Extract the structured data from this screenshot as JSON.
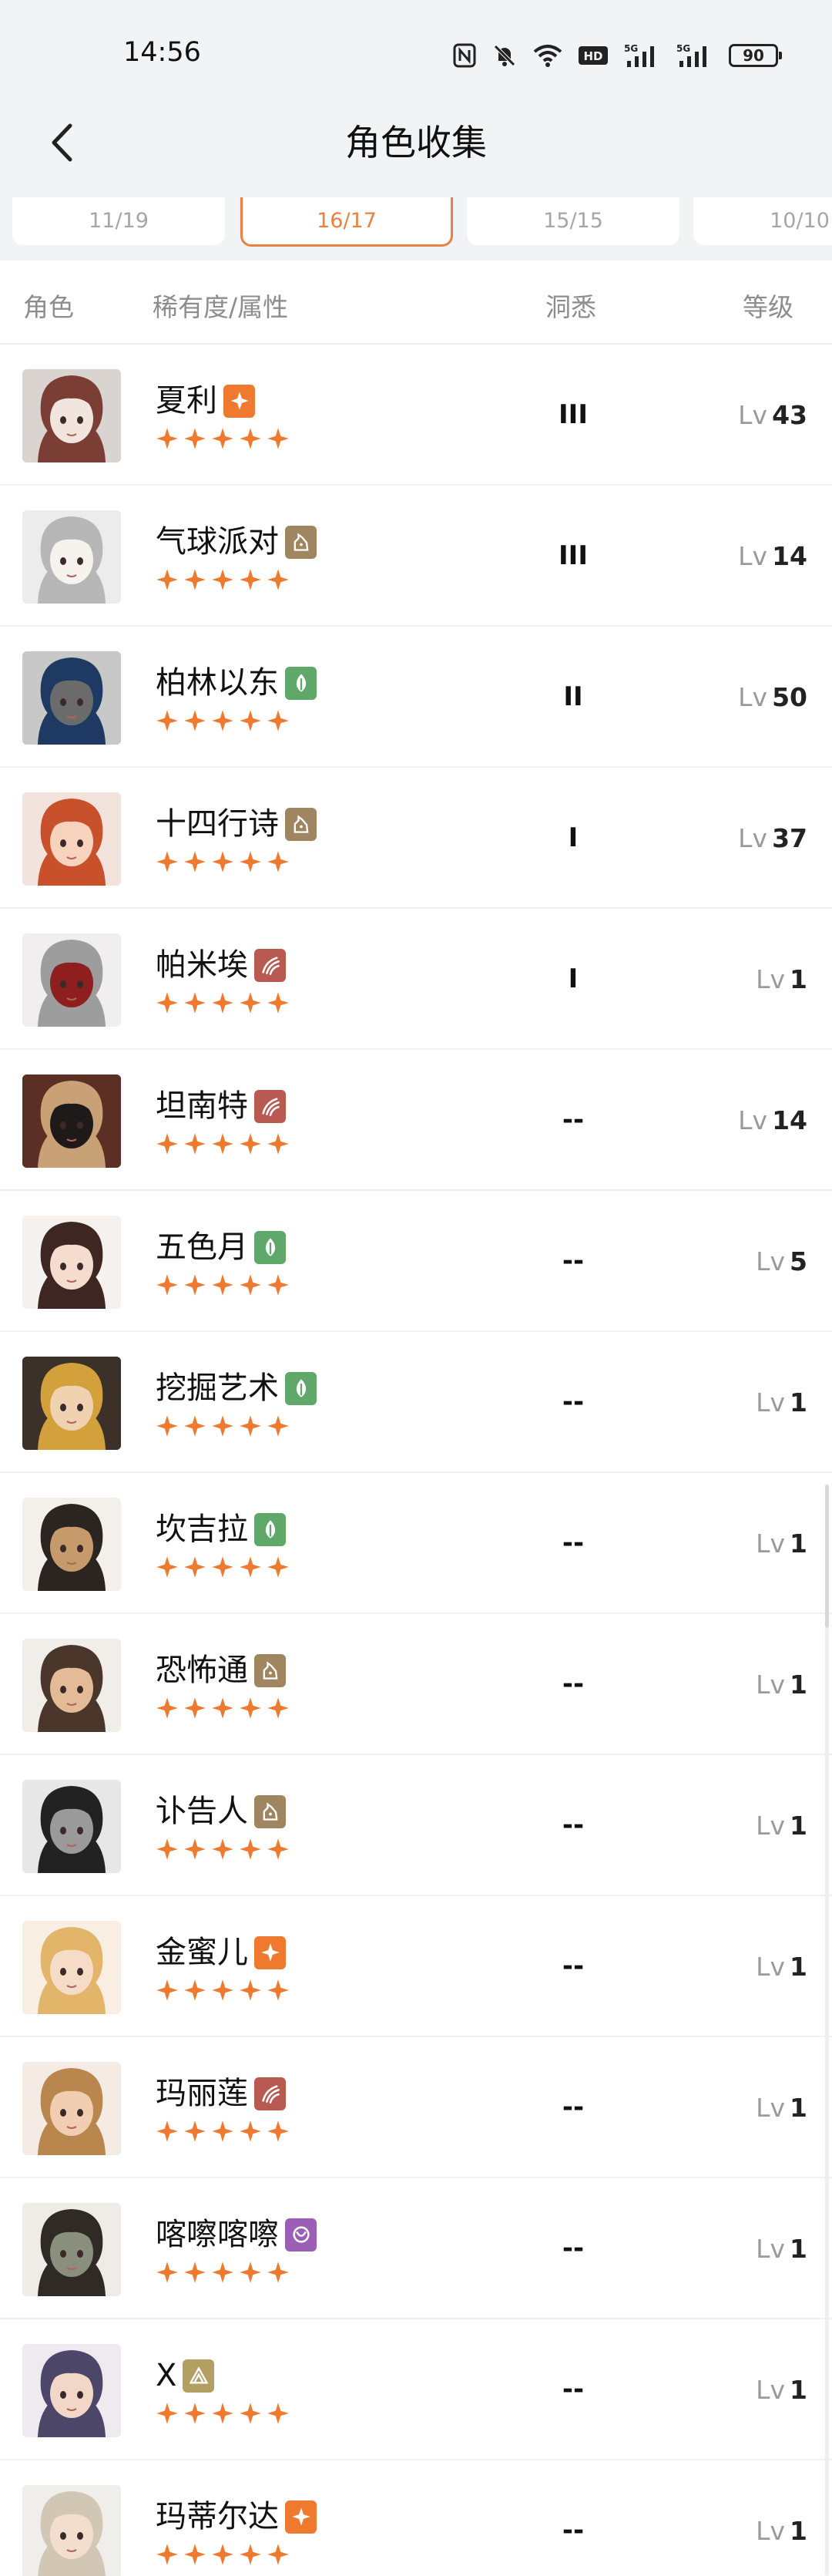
{
  "status": {
    "time": "14:56",
    "battery": "90"
  },
  "header": {
    "title": "角色收集"
  },
  "tabs": [
    "11/19",
    "16/17",
    "15/15",
    "10/10"
  ],
  "columns": {
    "character": "角色",
    "rarity": "稀有度/属性",
    "familiarity": "洞悉",
    "level": "等级"
  },
  "level_prefix": "Lv",
  "colors": {
    "accent": "#e98240",
    "star": "#ef7a2f",
    "star_attr": "#4f86c9",
    "beast": "#a08660",
    "plant": "#5fa86a",
    "mineral": "#b85a52",
    "spirit": "#9b5fb8",
    "intellect": "#b2a062"
  },
  "characters": [
    {
      "name": "夏利",
      "attr": "star",
      "attr_icon": "star-attribute-icon",
      "stars": 5,
      "familiarity": "III",
      "level": "43",
      "avatar": [
        "#d9d4cf",
        "#7a3e35",
        "#f2e5de"
      ]
    },
    {
      "name": "气球派对",
      "attr": "beast",
      "attr_icon": "beast-attribute-icon",
      "stars": 5,
      "familiarity": "III",
      "level": "14",
      "avatar": [
        "#ececec",
        "#b7b7b7",
        "#f6f2ee"
      ]
    },
    {
      "name": "柏林以东",
      "attr": "plant",
      "attr_icon": "plant-attribute-icon",
      "stars": 5,
      "familiarity": "II",
      "level": "50",
      "avatar": [
        "#c8c8c8",
        "#1e3a63",
        "#6b6b6b"
      ]
    },
    {
      "name": "十四行诗",
      "attr": "beast",
      "attr_icon": "beast-attribute-icon",
      "stars": 5,
      "familiarity": "I",
      "level": "37",
      "avatar": [
        "#f2e3dc",
        "#c8502a",
        "#f7d2bd"
      ]
    },
    {
      "name": "帕米埃",
      "attr": "mineral",
      "attr_icon": "mineral-attribute-icon",
      "stars": 5,
      "familiarity": "I",
      "level": "1",
      "avatar": [
        "#f0eeee",
        "#9d9d9d",
        "#8f1e1e"
      ]
    },
    {
      "name": "坦南特",
      "attr": "mineral",
      "attr_icon": "mineral-attribute-icon",
      "stars": 5,
      "familiarity": "--",
      "level": "14",
      "avatar": [
        "#5c2f25",
        "#c9a177",
        "#1f1a1a"
      ]
    },
    {
      "name": "五色月",
      "attr": "plant",
      "attr_icon": "plant-attribute-icon",
      "stars": 5,
      "familiarity": "--",
      "level": "5",
      "avatar": [
        "#f4f1ef",
        "#3e2722",
        "#f5dccf"
      ]
    },
    {
      "name": "挖掘艺术",
      "attr": "plant",
      "attr_icon": "plant-attribute-icon",
      "stars": 5,
      "familiarity": "--",
      "level": "1",
      "avatar": [
        "#3b3129",
        "#d3a13b",
        "#f0d1b0"
      ]
    },
    {
      "name": "坎吉拉",
      "attr": "plant",
      "attr_icon": "plant-attribute-icon",
      "stars": 5,
      "familiarity": "--",
      "level": "1",
      "avatar": [
        "#f3efea",
        "#2b2421",
        "#c79a6c"
      ]
    },
    {
      "name": "恐怖通",
      "attr": "beast",
      "attr_icon": "beast-attribute-icon",
      "stars": 5,
      "familiarity": "--",
      "level": "1",
      "avatar": [
        "#f1ede9",
        "#4b362b",
        "#e3bb96"
      ]
    },
    {
      "name": "讣告人",
      "attr": "beast",
      "attr_icon": "beast-attribute-icon",
      "stars": 5,
      "familiarity": "--",
      "level": "1",
      "avatar": [
        "#e7e7e7",
        "#222222",
        "#9a9a9a"
      ]
    },
    {
      "name": "金蜜儿",
      "attr": "star",
      "attr_icon": "star-attribute-icon",
      "stars": 5,
      "familiarity": "--",
      "level": "1",
      "avatar": [
        "#f8efe2",
        "#e2b56a",
        "#f6dcc6"
      ]
    },
    {
      "name": "玛丽莲",
      "attr": "mineral",
      "attr_icon": "mineral-attribute-icon",
      "stars": 5,
      "familiarity": "--",
      "level": "1",
      "avatar": [
        "#f4ece4",
        "#b9874d",
        "#f1cdb2"
      ]
    },
    {
      "name": "喀嚓喀嚓",
      "attr": "spirit",
      "attr_icon": "spirit-attribute-icon",
      "stars": 5,
      "familiarity": "--",
      "level": "1",
      "avatar": [
        "#efebe7",
        "#2f2a26",
        "#8a8f7d"
      ]
    },
    {
      "name": "X",
      "attr": "intellect",
      "attr_icon": "intellect-attribute-icon",
      "stars": 5,
      "familiarity": "--",
      "level": "1",
      "avatar": [
        "#eeeaf0",
        "#4c4668",
        "#f2d6c8"
      ]
    },
    {
      "name": "玛蒂尔达",
      "attr": "star",
      "attr_icon": "star-attribute-icon",
      "stars": 5,
      "familiarity": "--",
      "level": "1",
      "avatar": [
        "#f0eeea",
        "#d2c7b4",
        "#f3ddcf"
      ]
    }
  ]
}
